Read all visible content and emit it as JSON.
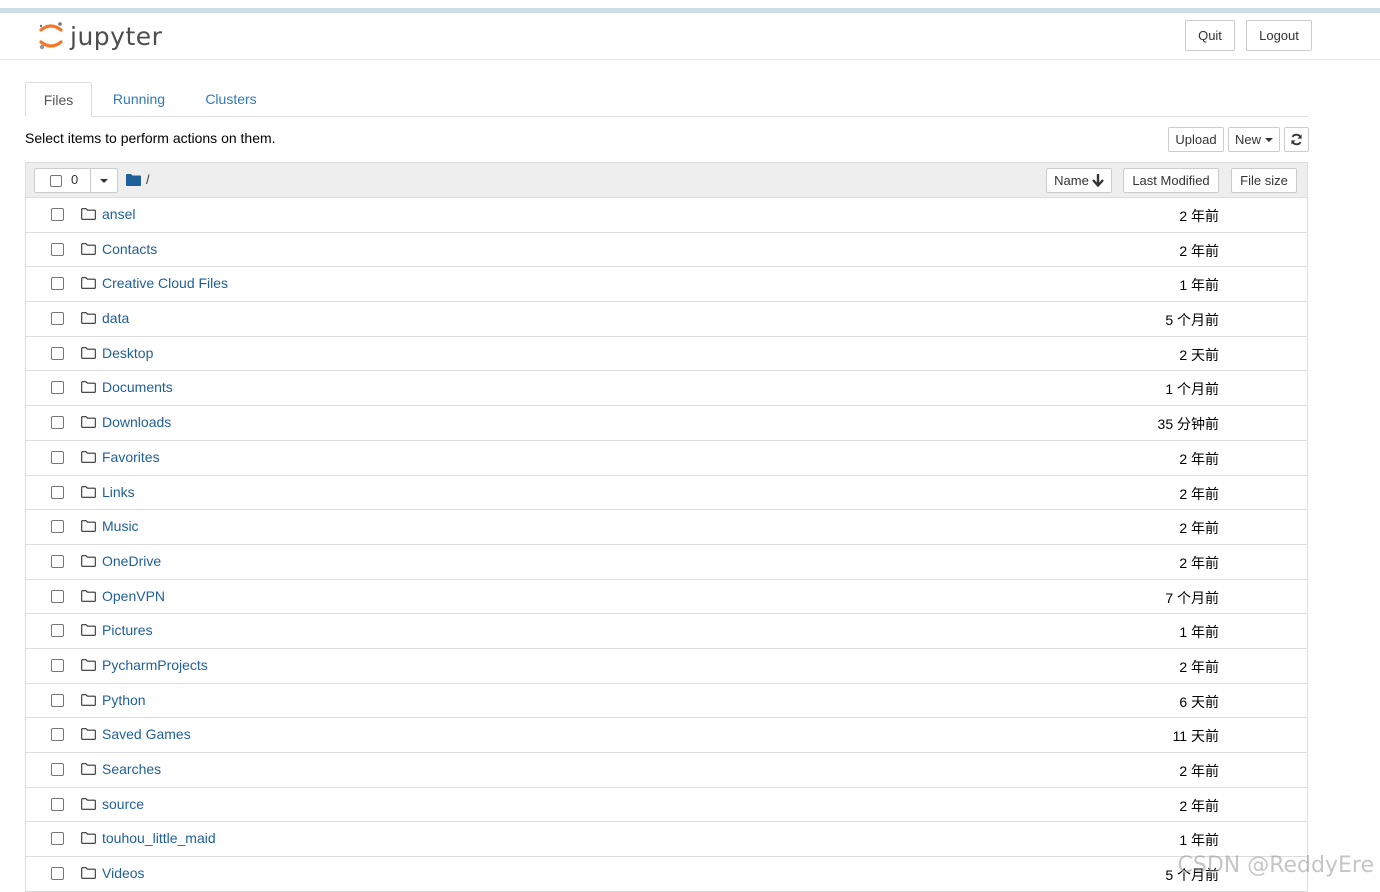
{
  "header": {
    "logo_text": "jupyter",
    "quit_label": "Quit",
    "logout_label": "Logout"
  },
  "tabs": [
    {
      "label": "Files",
      "active": true
    },
    {
      "label": "Running",
      "active": false
    },
    {
      "label": "Clusters",
      "active": false
    }
  ],
  "toolbar": {
    "hint": "Select items to perform actions on them.",
    "upload_label": "Upload",
    "new_label": "New",
    "refresh_icon": "refresh-icon"
  },
  "list_header": {
    "selected_count": "0",
    "breadcrumb": "/",
    "name_label": "Name",
    "last_modified_label": "Last Modified",
    "file_size_label": "File size"
  },
  "files": [
    {
      "name": "ansel",
      "modified": "2 年前"
    },
    {
      "name": "Contacts",
      "modified": "2 年前"
    },
    {
      "name": "Creative Cloud Files",
      "modified": "1 年前"
    },
    {
      "name": "data",
      "modified": "5 个月前"
    },
    {
      "name": "Desktop",
      "modified": "2 天前"
    },
    {
      "name": "Documents",
      "modified": "1 个月前"
    },
    {
      "name": "Downloads",
      "modified": "35 分钟前"
    },
    {
      "name": "Favorites",
      "modified": "2 年前"
    },
    {
      "name": "Links",
      "modified": "2 年前"
    },
    {
      "name": "Music",
      "modified": "2 年前"
    },
    {
      "name": "OneDrive",
      "modified": "2 年前"
    },
    {
      "name": "OpenVPN",
      "modified": "7 个月前"
    },
    {
      "name": "Pictures",
      "modified": "1 年前"
    },
    {
      "name": "PycharmProjects",
      "modified": "2 年前"
    },
    {
      "name": "Python",
      "modified": "6 天前"
    },
    {
      "name": "Saved Games",
      "modified": "11 天前"
    },
    {
      "name": "Searches",
      "modified": "2 年前"
    },
    {
      "name": "source",
      "modified": "2 年前"
    },
    {
      "name": "touhou_little_maid",
      "modified": "1 年前"
    },
    {
      "name": "Videos",
      "modified": "5 个月前"
    }
  ],
  "watermark": "CSDN @ReddyEre",
  "colors": {
    "link": "#1f5f99",
    "tab_link": "#337ab7",
    "logo_orange": "#f37626"
  }
}
